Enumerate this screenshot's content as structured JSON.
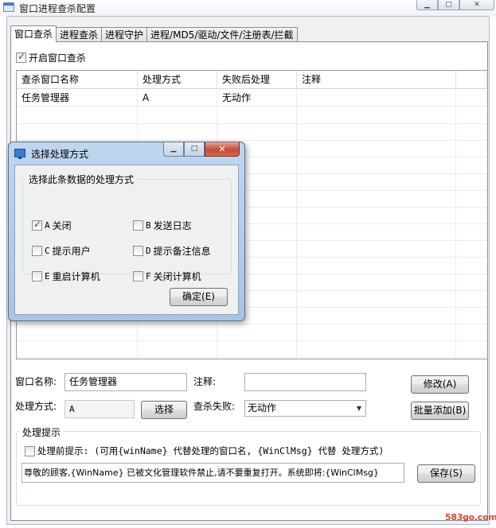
{
  "window": {
    "title": "窗口进程查杀配置",
    "minimize_glyph": "▁",
    "maximize_glyph": "□",
    "close_glyph": "✕"
  },
  "tabs": [
    {
      "label": "窗口查杀",
      "active": true
    },
    {
      "label": "进程查杀",
      "active": false
    },
    {
      "label": "进程守护",
      "active": false
    },
    {
      "label": "进程/MD5/驱动/文件/注册表/拦截",
      "active": false
    }
  ],
  "enable_window_kill": {
    "label": "开启窗口查杀",
    "checked": true
  },
  "grid": {
    "columns": [
      "查杀窗口名称",
      "处理方式",
      "失败后处理",
      "注释"
    ],
    "rows": [
      {
        "name": "任务管理器",
        "method": "A",
        "on_fail": "无动作",
        "note": ""
      }
    ]
  },
  "form": {
    "window_name_label": "窗口名称:",
    "window_name_value": "任务管理器",
    "note_label": "注释:",
    "note_value": "",
    "method_label": "处理方式:",
    "method_value": "A",
    "select_button": "选择",
    "fail_label": "查杀失败:",
    "fail_value": "无动作",
    "modify_button": "修改(A)",
    "batch_add_button": "批量添加(B)"
  },
  "handling_tip": {
    "group_title": "处理提示",
    "pre_prompt_label": "处理前提示: (可用{winName} 代替处理的窗口名, {WinClMsg} 代替 处理方式)",
    "pre_prompt_checked": false,
    "message_value": "尊敬的顾客,{WinName} 已被文化管理软件禁止,请不要重复打开。系统即将:{WinClMsg}",
    "save_button": "保存(S)"
  },
  "dialog": {
    "title": "选择处理方式",
    "minimize_glyph": "▁",
    "maximize_glyph": "□",
    "close_glyph": "✕",
    "group_title": "选择此条数据的处理方式",
    "options": [
      {
        "code": "A",
        "label": "关闭",
        "checked": true
      },
      {
        "code": "B",
        "label": "发送日志",
        "checked": false
      },
      {
        "code": "C",
        "label": "提示用户",
        "checked": false
      },
      {
        "code": "D",
        "label": "提示备注信息",
        "checked": false
      },
      {
        "code": "E",
        "label": "重启计算机",
        "checked": false
      },
      {
        "code": "F",
        "label": "关闭计算机",
        "checked": false
      }
    ],
    "ok_button": "确定(E)"
  },
  "watermark": "583go.com",
  "colors": {
    "accent": "#3b7bd4",
    "watermark": "#d64a3a",
    "dialog_frame": "#a9c4e2",
    "close_button": "#c44a32"
  }
}
